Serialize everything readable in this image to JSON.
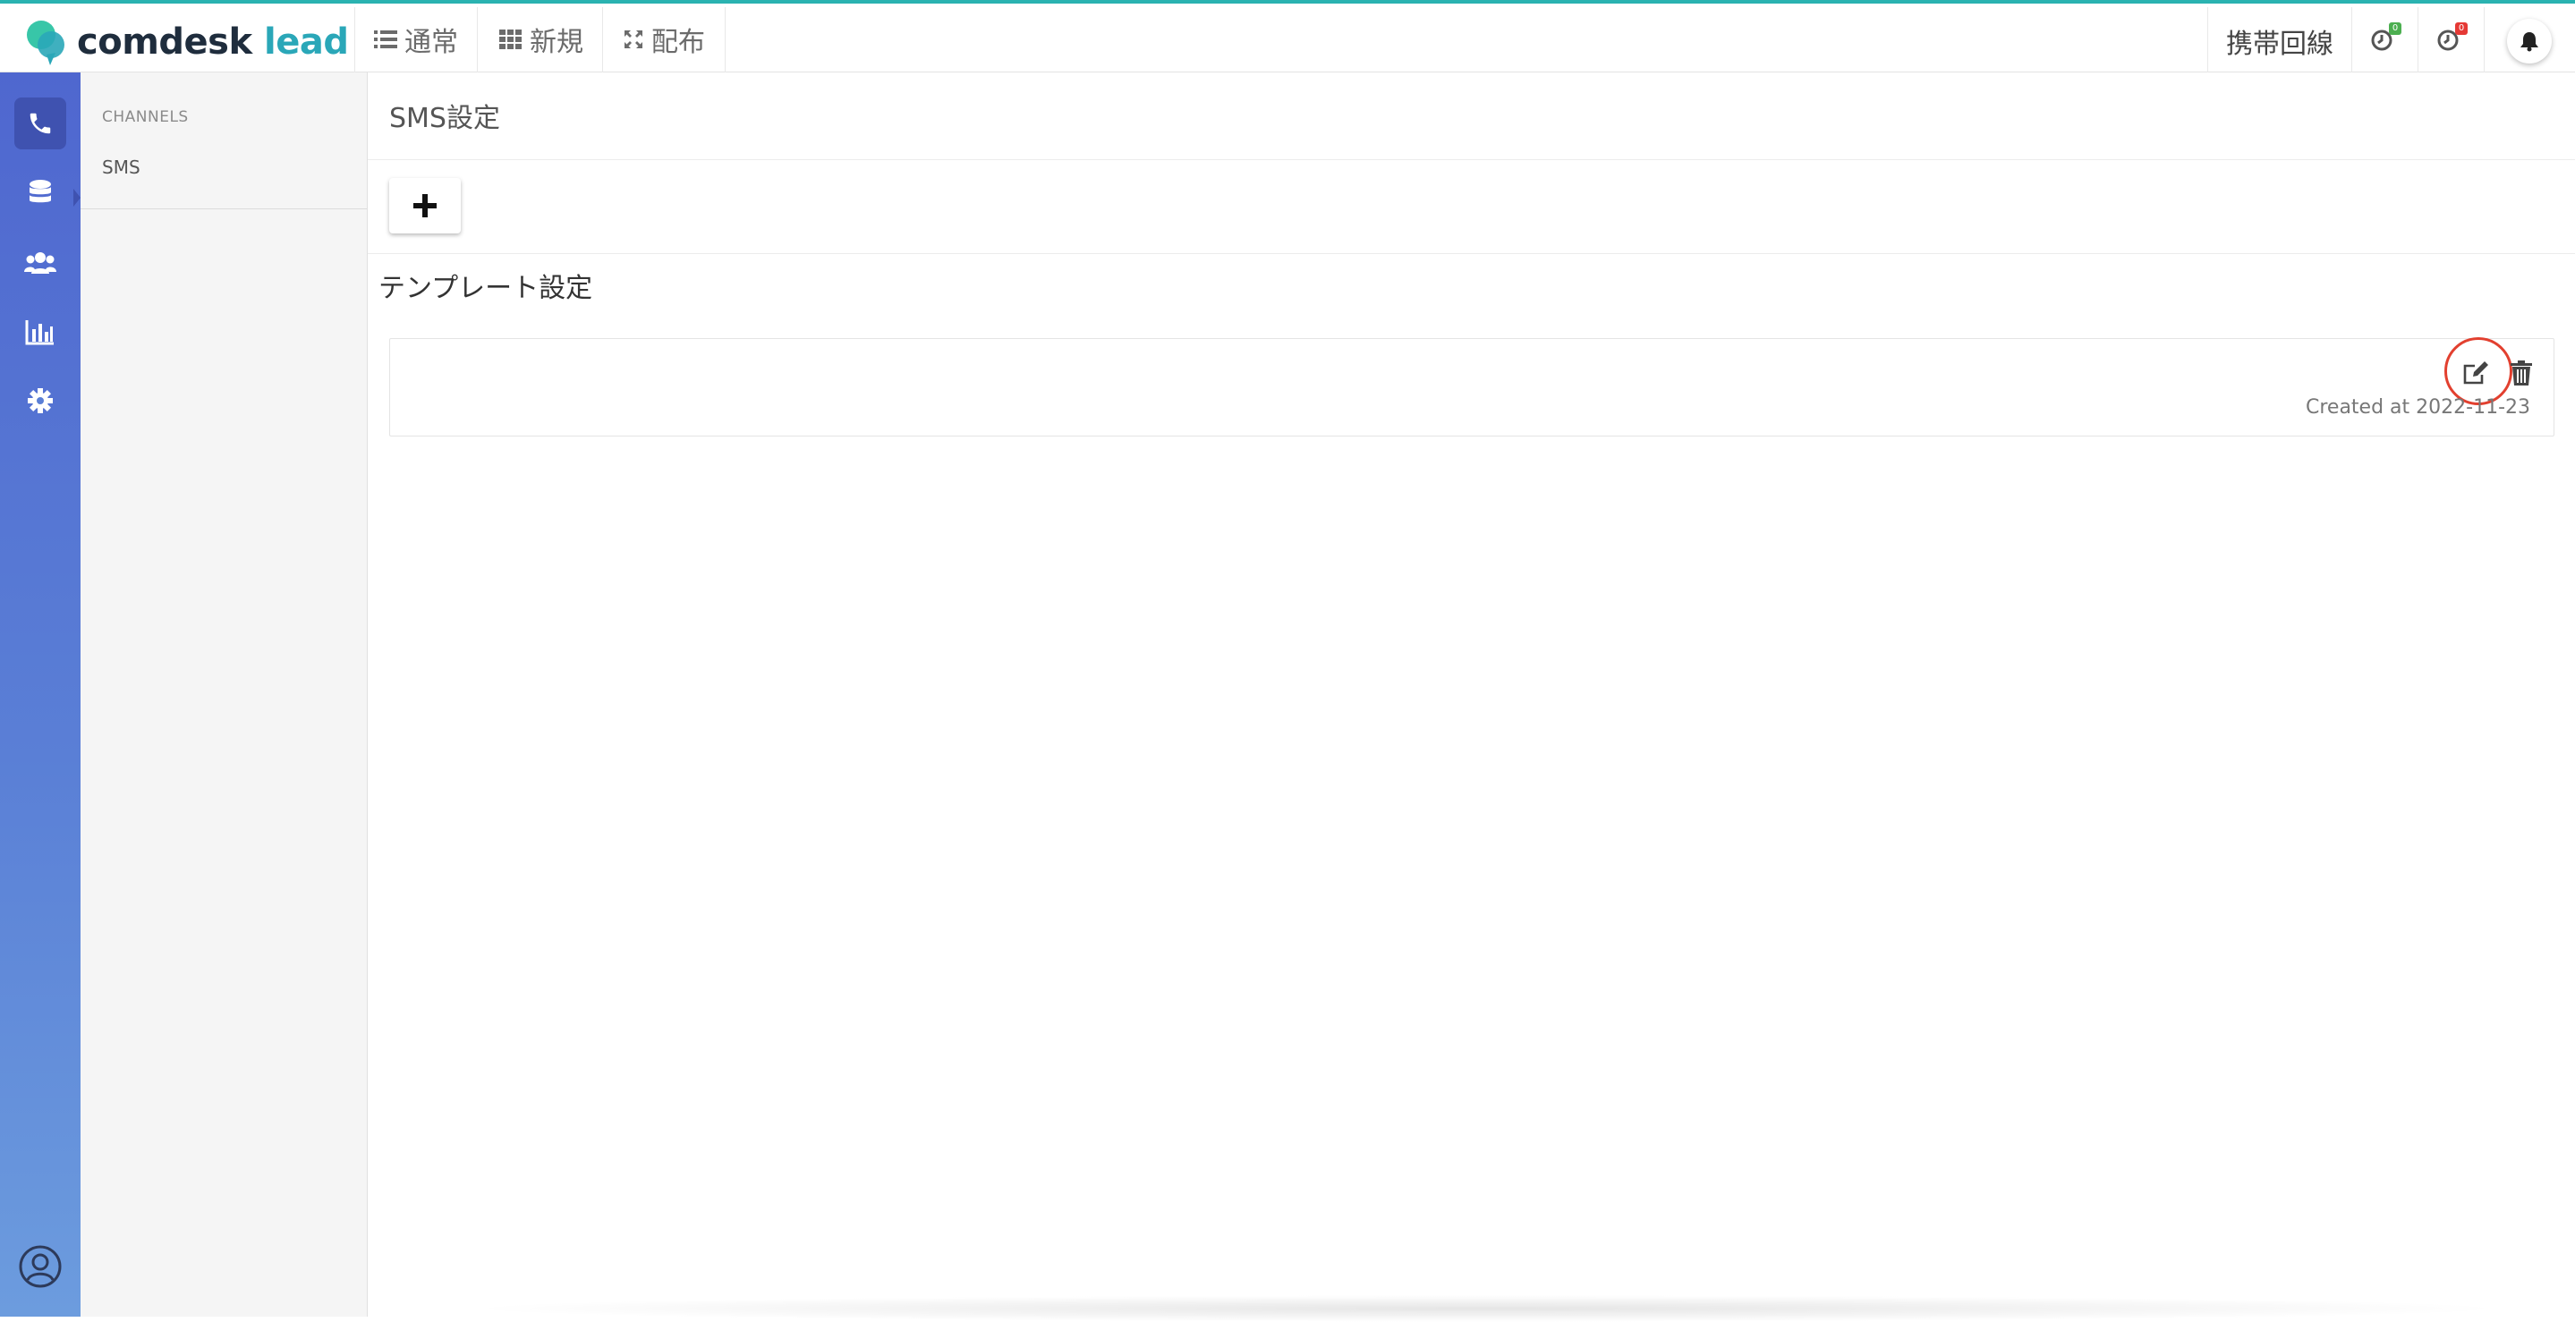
{
  "brand": {
    "name_primary": "comdesk",
    "name_accent": "lead"
  },
  "header": {
    "nav": [
      {
        "icon": "list-icon",
        "label": "通常"
      },
      {
        "icon": "grid-icon",
        "label": "新規"
      },
      {
        "icon": "expand-arrows-icon",
        "label": "配布"
      }
    ],
    "line_label": "携帯回線",
    "timer_green_badge": "0",
    "timer_red_badge": "0"
  },
  "rail": {
    "items": [
      "phone-icon",
      "database-icon",
      "users-icon",
      "bar-chart-icon",
      "gear-icon"
    ],
    "bottom": "user-circle-icon"
  },
  "sidebar": {
    "section": "CHANNELS",
    "items": [
      {
        "label": "SMS"
      }
    ]
  },
  "main": {
    "title": "SMS設定",
    "add_label": "+",
    "section_title": "テンプレート設定",
    "templates": [
      {
        "created": "Created at 2022-11-23"
      }
    ]
  },
  "colors": {
    "accent_teal": "#2aa7b8",
    "rail_top": "#4f67cf",
    "rail_bottom": "#6c9cde",
    "highlight": "#e2402f"
  }
}
